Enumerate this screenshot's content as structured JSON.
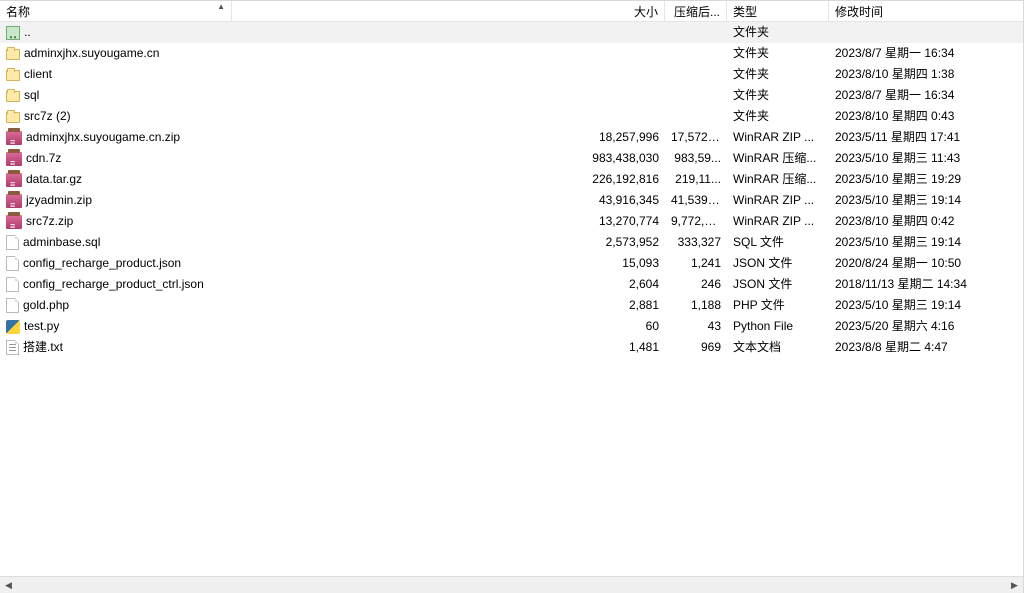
{
  "columns": {
    "name": "名称",
    "size": "大小",
    "packed": "压缩后...",
    "type": "类型",
    "modified": "修改时间"
  },
  "rows": [
    {
      "icon": "up",
      "name": "..",
      "size": "",
      "packed": "",
      "type": "文件夹",
      "modified": "",
      "selected": true
    },
    {
      "icon": "folder",
      "name": "adminxjhx.suyougame.cn",
      "size": "",
      "packed": "",
      "type": "文件夹",
      "modified": "2023/8/7 星期一 16:34"
    },
    {
      "icon": "folder",
      "name": "client",
      "size": "",
      "packed": "",
      "type": "文件夹",
      "modified": "2023/8/10 星期四 1:38"
    },
    {
      "icon": "folder",
      "name": "sql",
      "size": "",
      "packed": "",
      "type": "文件夹",
      "modified": "2023/8/7 星期一 16:34"
    },
    {
      "icon": "folder",
      "name": "src7z (2)",
      "size": "",
      "packed": "",
      "type": "文件夹",
      "modified": "2023/8/10 星期四 0:43"
    },
    {
      "icon": "archive",
      "name": "adminxjhx.suyougame.cn.zip",
      "size": "18,257,996",
      "packed": "17,572,...",
      "type": "WinRAR ZIP ...",
      "modified": "2023/5/11 星期四 17:41"
    },
    {
      "icon": "archive",
      "name": "cdn.7z",
      "size": "983,438,030",
      "packed": "983,59...",
      "type": "WinRAR 压缩...",
      "modified": "2023/5/10 星期三 11:43"
    },
    {
      "icon": "archive",
      "name": "data.tar.gz",
      "size": "226,192,816",
      "packed": "219,11...",
      "type": "WinRAR 压缩...",
      "modified": "2023/5/10 星期三 19:29"
    },
    {
      "icon": "archive",
      "name": "jzyadmin.zip",
      "size": "43,916,345",
      "packed": "41,539,...",
      "type": "WinRAR ZIP ...",
      "modified": "2023/5/10 星期三 19:14"
    },
    {
      "icon": "archive",
      "name": "src7z.zip",
      "size": "13,270,774",
      "packed": "9,772,2...",
      "type": "WinRAR ZIP ...",
      "modified": "2023/8/10 星期四 0:42"
    },
    {
      "icon": "file",
      "name": "adminbase.sql",
      "size": "2,573,952",
      "packed": "333,327",
      "type": "SQL 文件",
      "modified": "2023/5/10 星期三 19:14"
    },
    {
      "icon": "file",
      "name": "config_recharge_product.json",
      "size": "15,093",
      "packed": "1,241",
      "type": "JSON 文件",
      "modified": "2020/8/24 星期一 10:50"
    },
    {
      "icon": "file",
      "name": "config_recharge_product_ctrl.json",
      "size": "2,604",
      "packed": "246",
      "type": "JSON 文件",
      "modified": "2018/11/13 星期二 14:34"
    },
    {
      "icon": "file",
      "name": "gold.php",
      "size": "2,881",
      "packed": "1,188",
      "type": "PHP 文件",
      "modified": "2023/5/10 星期三 19:14"
    },
    {
      "icon": "py",
      "name": "test.py",
      "size": "60",
      "packed": "43",
      "type": "Python File",
      "modified": "2023/5/20 星期六 4:16"
    },
    {
      "icon": "text",
      "name": "搭建.txt",
      "size": "1,481",
      "packed": "969",
      "type": "文本文档",
      "modified": "2023/8/8 星期二 4:47"
    }
  ]
}
